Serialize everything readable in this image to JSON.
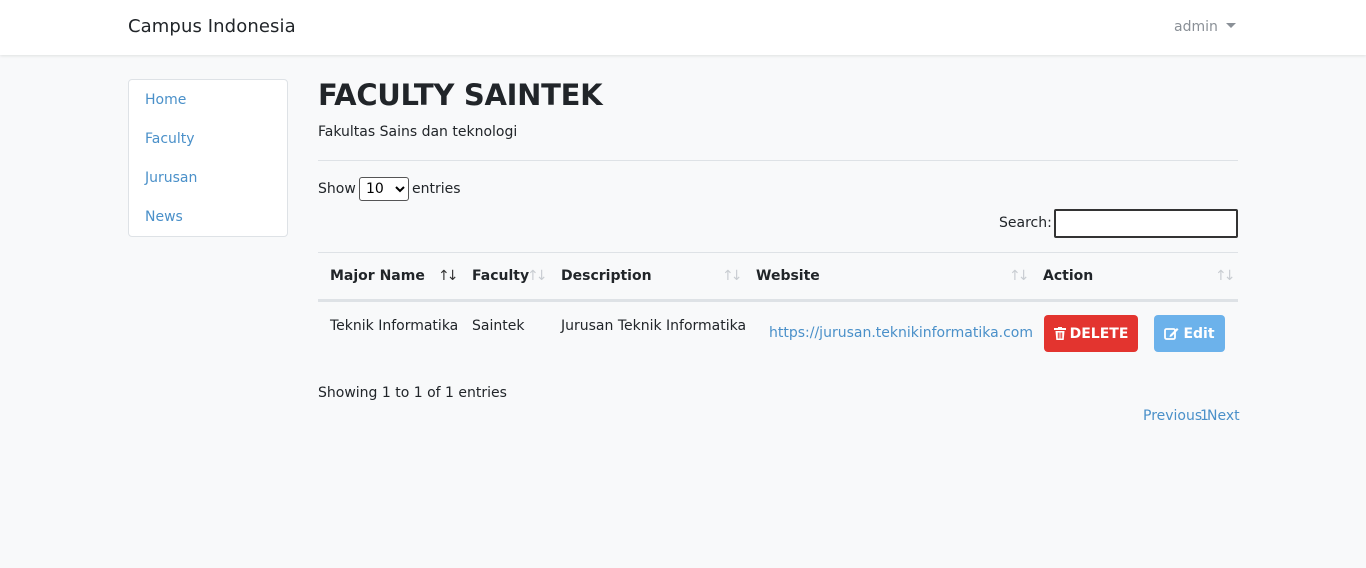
{
  "navbar": {
    "brand": "Campus Indonesia",
    "user": "admin"
  },
  "sidebar": {
    "items": [
      {
        "label": "Home"
      },
      {
        "label": "Faculty"
      },
      {
        "label": "Jurusan"
      },
      {
        "label": "News"
      }
    ]
  },
  "page": {
    "title": "FACULTY SAINTEK",
    "subtitle": "Fakultas Sains dan teknologi"
  },
  "table_controls": {
    "show_label": "Show",
    "entries_label": "entries",
    "length_value": "10",
    "length_options": [
      "10"
    ],
    "search_label": "Search:",
    "search_value": ""
  },
  "table": {
    "columns": [
      "Major Name",
      "Faculty",
      "Description",
      "Website",
      "Action"
    ],
    "rows": [
      {
        "major_name": "Teknik Informatika",
        "faculty": "Saintek",
        "description": "Jurusan Teknik Informatika",
        "website": "https://jurusan.teknikinformatika.com",
        "delete_label": "DELETE",
        "edit_label": "Edit"
      }
    ],
    "sort_indicator": "↑↓"
  },
  "footer": {
    "info": "Showing 1 to 1 of 1 entries",
    "previous": "Previous",
    "page": "1",
    "next": "Next"
  },
  "colors": {
    "delete": "#e3342f",
    "edit": "#6cb2eb",
    "link": "#4a90c9",
    "background": "#f8f9fa"
  },
  "icons": {
    "delete": "trash-icon",
    "edit": "edit-icon",
    "user_menu": "caret-down-icon"
  }
}
